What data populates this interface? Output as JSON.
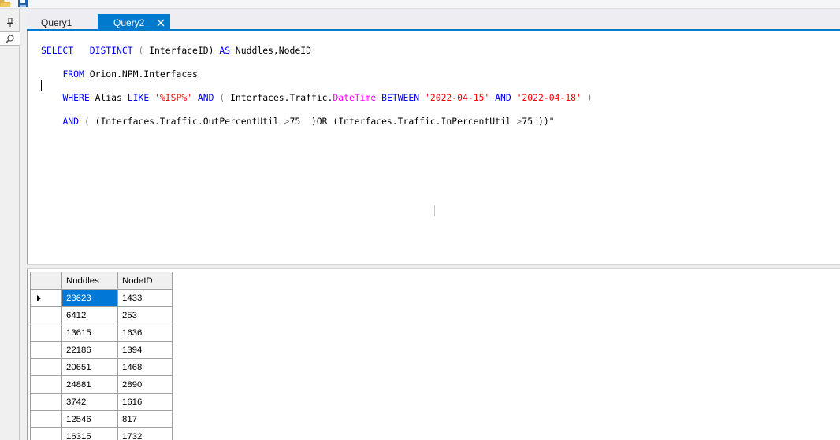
{
  "tabs": [
    {
      "label": "Query1",
      "active": false
    },
    {
      "label": "Query2",
      "active": true
    }
  ],
  "icons": {
    "folder": "folder-open-icon",
    "save": "save-icon",
    "pin": "pin-icon",
    "find": "magnifier-icon",
    "close": "close-icon"
  },
  "colors": {
    "accent": "#007acc",
    "selection": "#0078d7",
    "keyword": "#0000ff",
    "string": "#ff0000",
    "function": "#ff00ff"
  },
  "query": {
    "l1": [
      "SELECT",
      "DISTINCT",
      "(",
      "InterfaceID)",
      "AS",
      "Nuddles,NodeID"
    ],
    "l2": [
      "FROM",
      "Orion.NPM.Interfaces"
    ],
    "l3": [
      "WHERE",
      "Alias",
      "LIKE",
      "'%ISP%'",
      "AND",
      "(",
      "Interfaces.Traffic.",
      "DateTime",
      "BETWEEN",
      "'2022-04-15'",
      "AND",
      "'2022-04-18'",
      ")"
    ],
    "l4": [
      "AND",
      "(",
      "(Interfaces.Traffic.OutPercentUtil",
      ">",
      "75",
      ")OR",
      "(Interfaces.Traffic.InPercentUtil",
      ">",
      "75",
      "))\""
    ]
  },
  "results": {
    "columns": [
      "Nuddles",
      "NodeID"
    ],
    "rows": [
      [
        "23623",
        "1433"
      ],
      [
        "6412",
        "253"
      ],
      [
        "13615",
        "1636"
      ],
      [
        "22186",
        "1394"
      ],
      [
        "20651",
        "1468"
      ],
      [
        "24881",
        "2890"
      ],
      [
        "3742",
        "1616"
      ],
      [
        "12546",
        "817"
      ],
      [
        "16315",
        "1732"
      ]
    ]
  }
}
